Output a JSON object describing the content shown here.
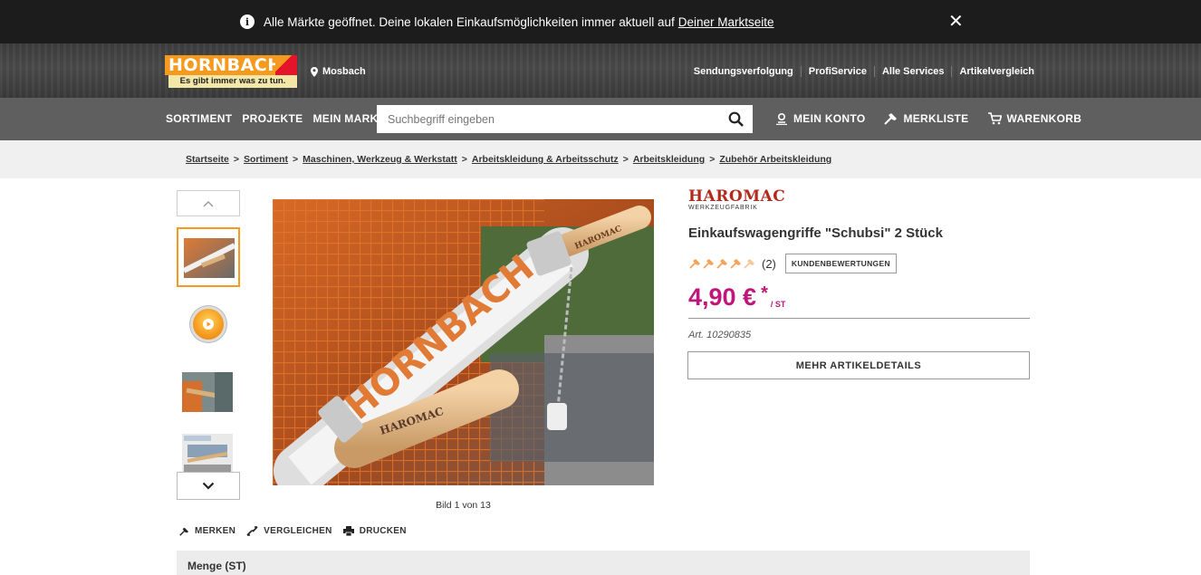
{
  "notice": {
    "text": "Alle Märkte geöffnet. Deine lokalen Einkaufsmöglichkeiten immer aktuell auf",
    "link": "Deiner Marktseite",
    "close": "✕"
  },
  "header": {
    "logo_text": "HORNBACH",
    "slogan": "Es gibt immer was zu tun.",
    "location": "Mosbach",
    "links": [
      "Sendungsverfolgung",
      "ProfiService",
      "Alle Services",
      "Artikelvergleich"
    ]
  },
  "nav": {
    "items": [
      "SORTIMENT",
      "PROJEKTE",
      "MEIN MARKT"
    ],
    "search_placeholder": "Suchbegriff eingeben",
    "account": "MEIN KONTO",
    "wishlist": "MERKLISTE",
    "cart": "WARENKORB"
  },
  "breadcrumb": [
    "Startseite",
    "Sortiment",
    "Maschinen, Werkzeug & Werkstatt",
    "Arbeitskleidung & Arbeitsschutz",
    "Arbeitskleidung",
    "Zubehör Arbeitskleidung"
  ],
  "gallery": {
    "caption": "Bild 1 von 13"
  },
  "actions": {
    "merken": "MERKEN",
    "vergleichen": "VERGLEICHEN",
    "drucken": "DRUCKEN"
  },
  "product": {
    "brand": "HAROMAC",
    "brand_sub": "WERKZEUGFABRIK",
    "title": "Einkaufswagengriffe \"Schubsi\" 2 Stück",
    "rating": 0,
    "rating_count": "(2)",
    "review_button": "KUNDENBEWERTUNGEN",
    "price": "4,90 €",
    "price_star": "*",
    "price_unit": "/ ST",
    "article": "Art. 10290835",
    "details_button": "MEHR ARTIKELDETAILS",
    "quantity_label": "Menge (ST)"
  },
  "colors": {
    "accent": "#f59a1e",
    "price": "#c0157b",
    "brand": "#b12a1d"
  }
}
